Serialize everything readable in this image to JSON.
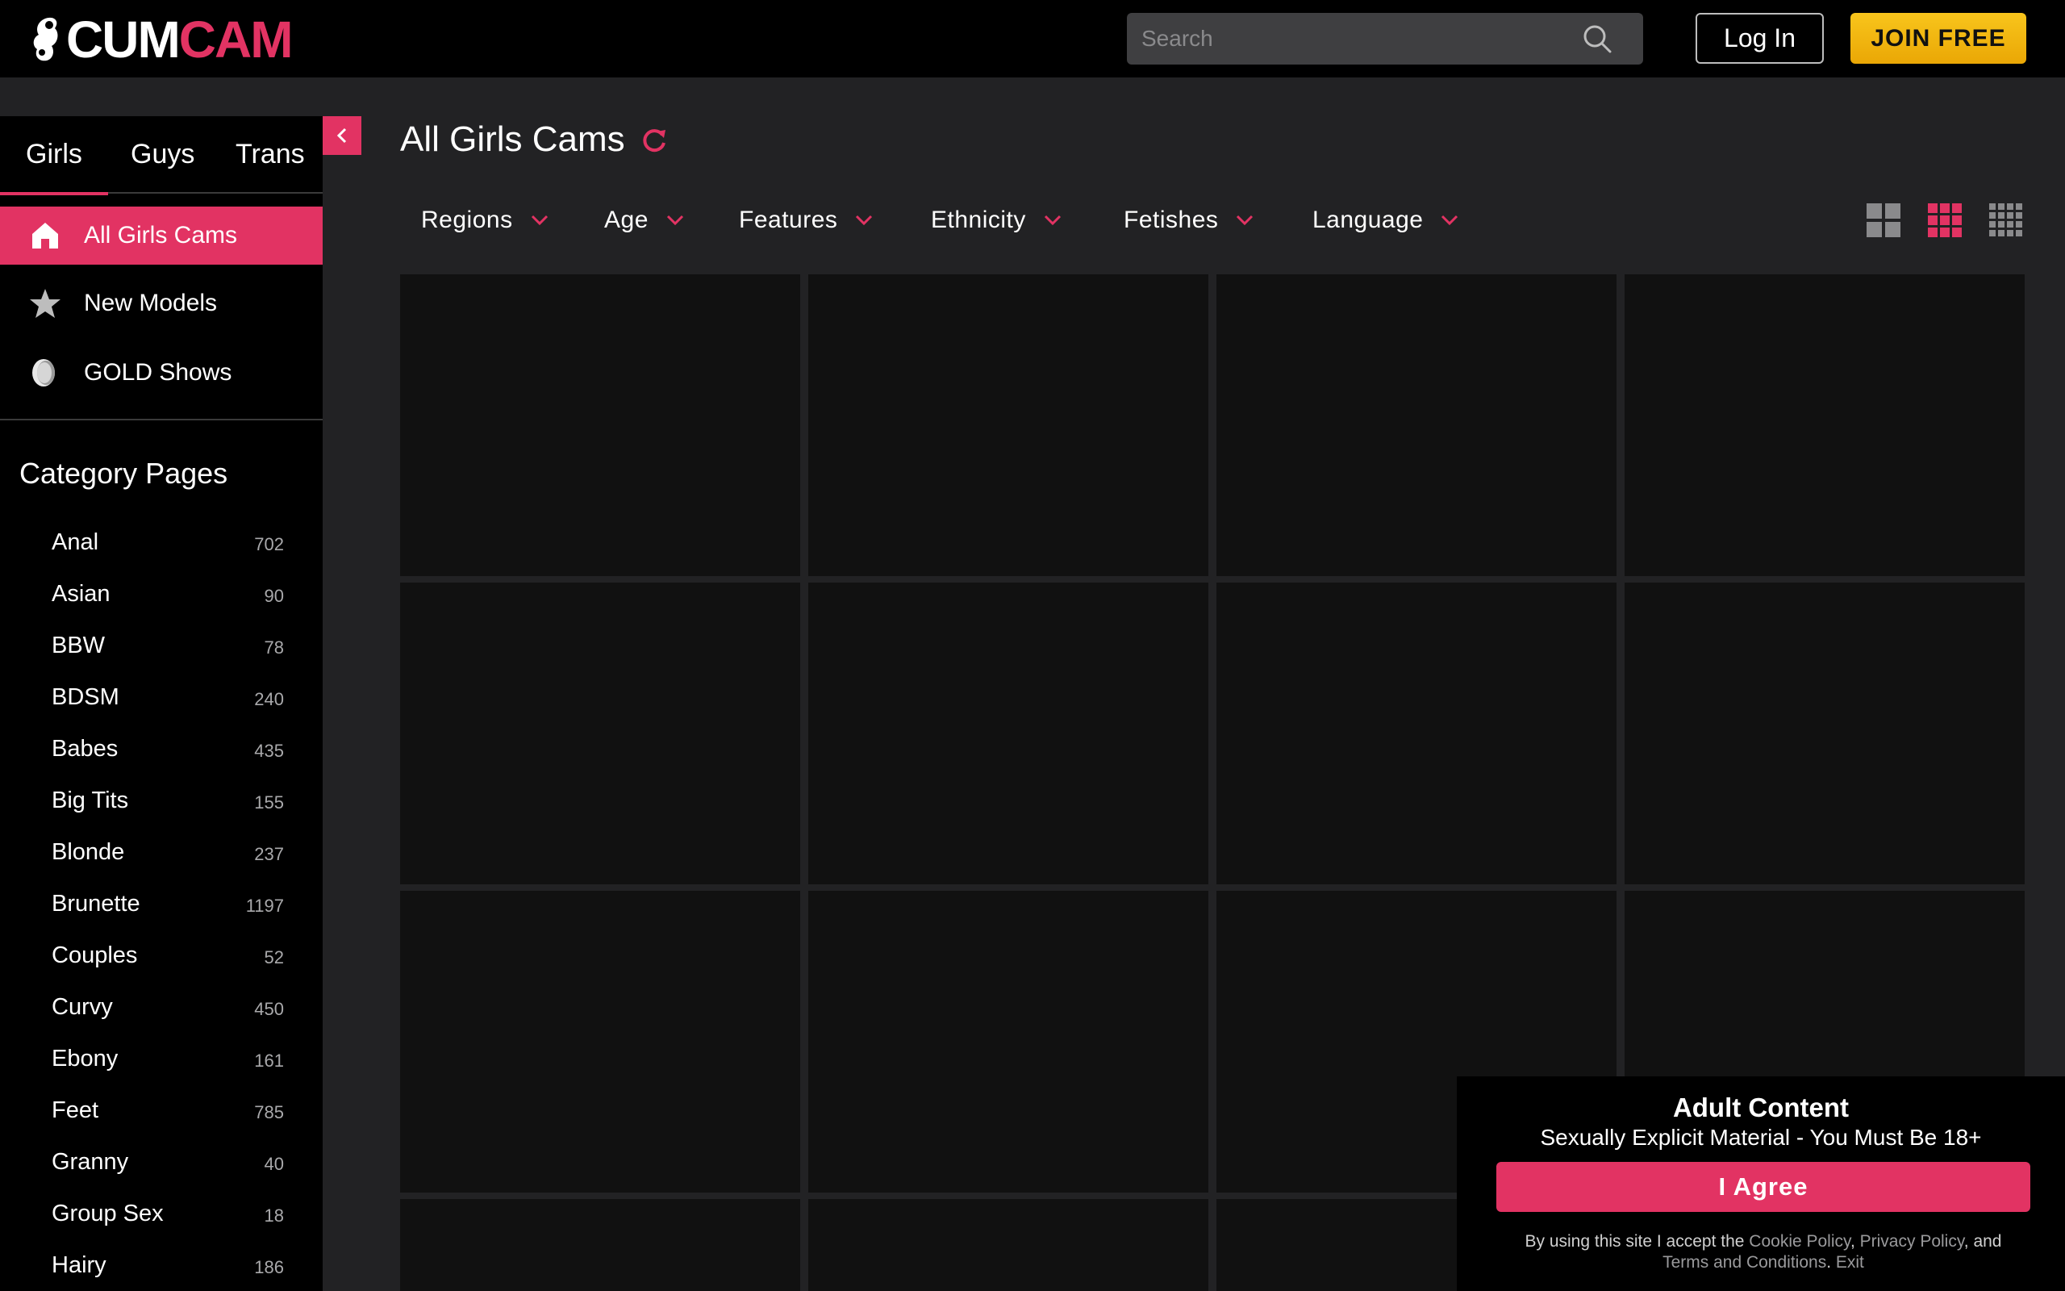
{
  "header": {
    "logo_part1": "CUM",
    "logo_part2": "CAM",
    "search_placeholder": "Search",
    "login_label": "Log In",
    "join_label": "JOIN FREE"
  },
  "sidebar": {
    "gender_tabs": [
      {
        "label": "Girls",
        "active": true
      },
      {
        "label": "Guys",
        "active": false
      },
      {
        "label": "Trans",
        "active": false
      }
    ],
    "nav_items": [
      {
        "label": "All Girls Cams",
        "icon": "home-icon",
        "active": true
      },
      {
        "label": "New Models",
        "icon": "star-icon",
        "active": false
      },
      {
        "label": "GOLD Shows",
        "icon": "gold-coin-icon",
        "active": false
      }
    ],
    "category_title": "Category Pages",
    "categories": [
      {
        "name": "Anal",
        "count": "702"
      },
      {
        "name": "Asian",
        "count": "90"
      },
      {
        "name": "BBW",
        "count": "78"
      },
      {
        "name": "BDSM",
        "count": "240"
      },
      {
        "name": "Babes",
        "count": "435"
      },
      {
        "name": "Big Tits",
        "count": "155"
      },
      {
        "name": "Blonde",
        "count": "237"
      },
      {
        "name": "Brunette",
        "count": "1197"
      },
      {
        "name": "Couples",
        "count": "52"
      },
      {
        "name": "Curvy",
        "count": "450"
      },
      {
        "name": "Ebony",
        "count": "161"
      },
      {
        "name": "Feet",
        "count": "785"
      },
      {
        "name": "Granny",
        "count": "40"
      },
      {
        "name": "Group Sex",
        "count": "18"
      },
      {
        "name": "Hairy",
        "count": "186"
      }
    ]
  },
  "main": {
    "title": "All Girls Cams",
    "filters": [
      "Regions",
      "Age",
      "Features",
      "Ethnicity",
      "Fetishes",
      "Language"
    ],
    "view_options": [
      "large-grid-icon",
      "medium-grid-icon",
      "small-grid-icon"
    ],
    "active_view": "medium-grid-icon"
  },
  "consent": {
    "title": "Adult Content",
    "subtitle": "Sexually Explicit Material - You Must Be 18+",
    "agree_label": "I Agree",
    "legal_prefix": "By using this site I accept the ",
    "cookie_policy": "Cookie Policy",
    "comma": ", ",
    "privacy_policy": "Privacy Policy",
    "and": ", and ",
    "terms": "Terms and Conditions",
    "dot": ". ",
    "exit": "Exit"
  },
  "colors": {
    "accent": "#e23363",
    "join": "#f5b80f",
    "header_bg": "#000000",
    "page_bg": "#222224",
    "tile_bg": "#111111"
  }
}
